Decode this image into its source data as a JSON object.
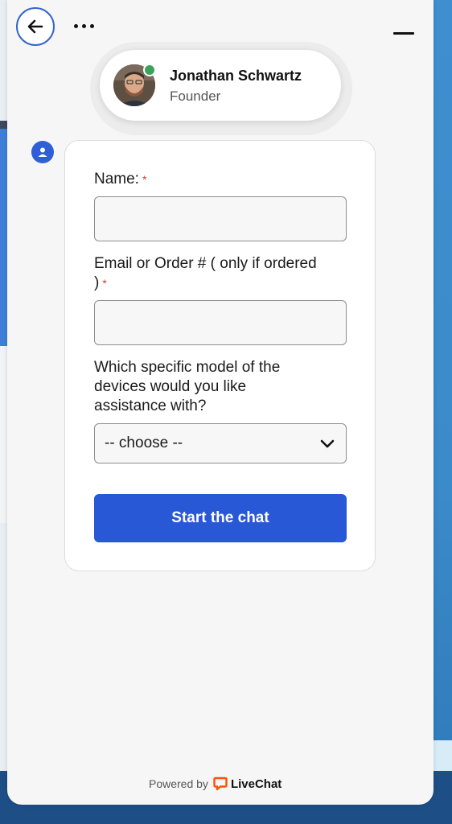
{
  "agent": {
    "name": "Jonathan Schwartz",
    "title": "Founder",
    "status_color": "#3aa35b"
  },
  "form": {
    "name_label": "Name:",
    "email_label_line1": "Email or Order # ( only if ordered",
    "email_label_line2": ")",
    "required_mark": "*",
    "model_label_line1": "Which specific model of the",
    "model_label_line2": "devices would you like",
    "model_label_line3": "assistance with?",
    "model_selected": "-- choose --",
    "submit_label": "Start the chat"
  },
  "footer": {
    "powered_by": "Powered by",
    "brand": "LiveChat",
    "brand_color": "#ff5100"
  },
  "colors": {
    "accent": "#2858d6",
    "required": "#d33a2c"
  },
  "icons": {
    "back": "arrow-left-icon",
    "more": "more-dots-icon",
    "minimize": "minimize-icon",
    "bot": "user-icon",
    "select": "chevron-down-icon"
  }
}
